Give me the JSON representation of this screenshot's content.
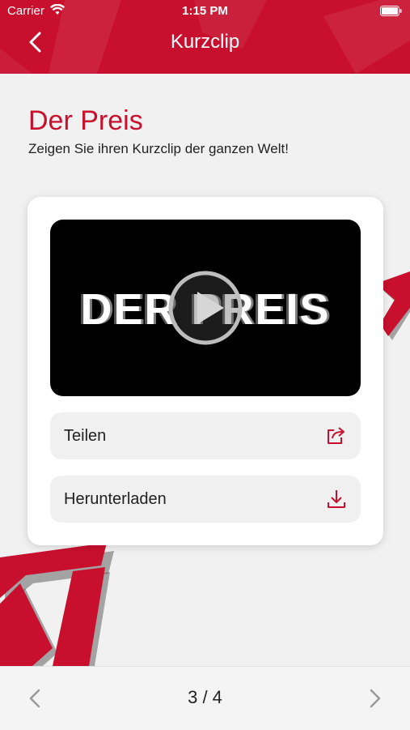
{
  "statusbar": {
    "carrier": "Carrier",
    "time": "1:15 PM"
  },
  "nav": {
    "title": "Kurzclip"
  },
  "page": {
    "title": "Der Preis",
    "subtitle": "Zeigen Sie ihren Kurzclip der ganzen Welt!"
  },
  "video": {
    "overlay_text": "DER PREIS"
  },
  "actions": {
    "share_label": "Teilen",
    "download_label": "Herunterladen"
  },
  "pager": {
    "text": "3 / 4"
  },
  "colors": {
    "brand": "#c8102e",
    "background": "#f1f1f1"
  },
  "icons": [
    "back-chevron-icon",
    "wifi-icon",
    "battery-icon",
    "play-icon",
    "share-icon",
    "download-icon",
    "chevron-left-icon",
    "chevron-right-icon"
  ]
}
